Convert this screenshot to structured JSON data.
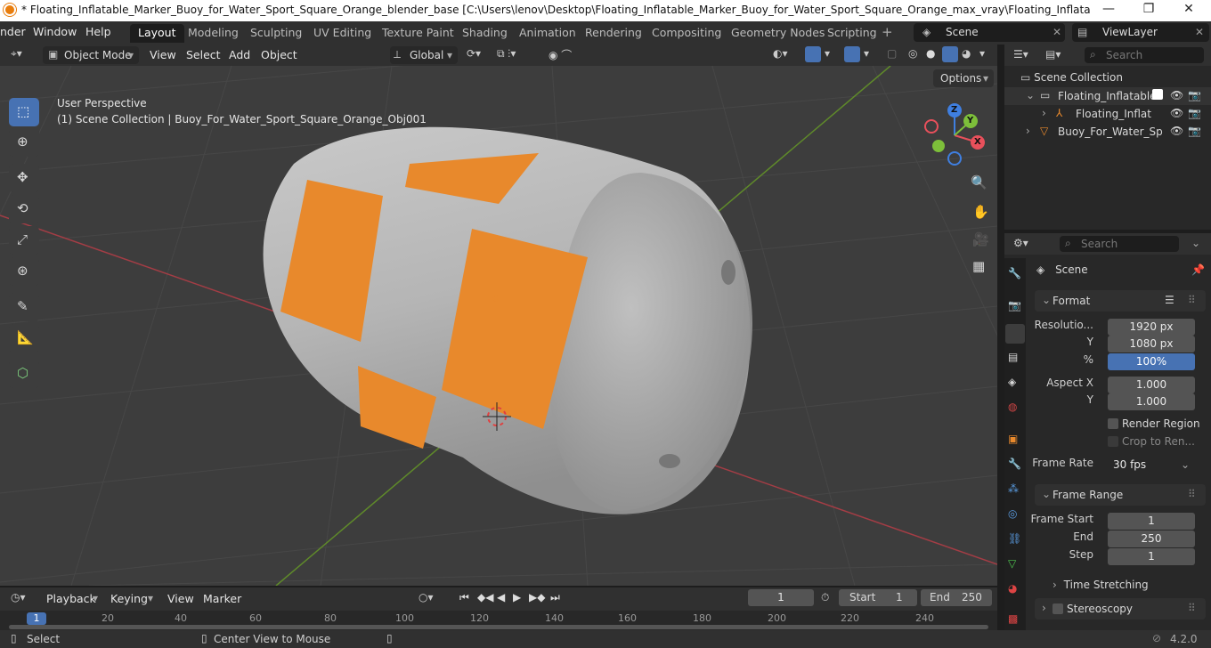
{
  "title_bar": {
    "title": "* Floating_Inflatable_Marker_Buoy_for_Water_Sport_Square_Orange_blender_base [C:\\Users\\lenov\\Desktop\\Floating_Inflatable_Marker_Buoy_for_Water_Sport_Square_Orange_max_vray\\Floating_Inflatable_Marker_Buoy_for_Wat...",
    "minimize": "—",
    "maximize": "❐",
    "close": "✕"
  },
  "menubar": {
    "menus": [
      "nder",
      "Window",
      "Help"
    ],
    "workspaces": [
      "Layout",
      "Modeling",
      "Sculpting",
      "UV Editing",
      "Texture Paint",
      "Shading",
      "Animation",
      "Rendering",
      "Compositing",
      "Geometry Nodes",
      "Scripting"
    ],
    "active_workspace": "Layout",
    "add_tab": "+",
    "scene": "Scene",
    "view_layer": "ViewLayer"
  },
  "viewport_header": {
    "mode": "Object Mode",
    "menus": [
      "View",
      "Select",
      "Add",
      "Object"
    ],
    "transform_orientation": "Global",
    "options": "Options"
  },
  "viewport": {
    "perspective": "User Perspective",
    "collection_info": "(1) Scene Collection | Buoy_For_Water_Sport_Square_Orange_Obj001",
    "gizmo": {
      "x": "X",
      "y": "Y",
      "z": "Z"
    }
  },
  "outliner": {
    "search_placeholder": "Search",
    "root": "Scene Collection",
    "items": [
      {
        "label": "Floating_Inflatable",
        "level": 1
      },
      {
        "label": "Floating_Inflat",
        "level": 2
      },
      {
        "label": "Buoy_For_Water_Sp",
        "level": 1
      }
    ]
  },
  "properties": {
    "search_placeholder": "Search",
    "context": "Scene",
    "format": {
      "title": "Format",
      "resolution_x_label": "Resolutio...",
      "resolution_x": "1920 px",
      "resolution_y_label": "Y",
      "resolution_y": "1080 px",
      "percent_label": "%",
      "percent": "100%",
      "aspect_x_label": "Aspect X",
      "aspect_x": "1.000",
      "aspect_y_label": "Y",
      "aspect_y": "1.000",
      "render_region": "Render Region",
      "crop": "Crop to Ren...",
      "frame_rate_label": "Frame Rate",
      "frame_rate": "30 fps"
    },
    "frame_range": {
      "title": "Frame Range",
      "start_label": "Frame Start",
      "start": "1",
      "end_label": "End",
      "end": "250",
      "step_label": "Step",
      "step": "1"
    },
    "time_stretching": "Time Stretching",
    "stereoscopy": "Stereoscopy"
  },
  "timeline": {
    "menus": [
      "Playback",
      "Keying",
      "View",
      "Marker"
    ],
    "current_frame": "1",
    "start_label": "Start",
    "start": "1",
    "end_label": "End",
    "end": "250",
    "ruler": [
      "1",
      "20",
      "40",
      "60",
      "80",
      "100",
      "120",
      "140",
      "160",
      "180",
      "200",
      "220",
      "240"
    ]
  },
  "statusbar": {
    "select": "Select",
    "center_view": "Center View to Mouse",
    "version": "4.2.0"
  },
  "colors": {
    "accent_blue": "#4772b3",
    "buoy_orange": "#e8892c",
    "axis_red": "#e8505b",
    "axis_green": "#7dbf3a",
    "axis_blue": "#3f7fe0"
  }
}
